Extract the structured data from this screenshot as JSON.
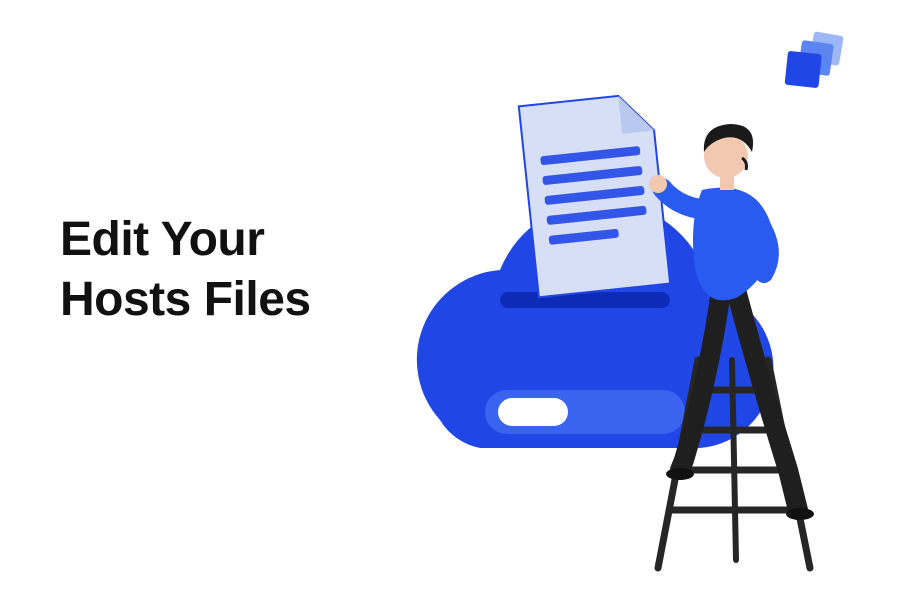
{
  "headline": {
    "line1": "Edit Your",
    "line2": "Hosts Files"
  },
  "colors": {
    "brand_primary": "#2146E6",
    "brand_light": "#5B86F2",
    "brand_lighter": "#9EB8F7",
    "document_fill": "#D6DFF5",
    "document_lines": "#3355E8",
    "skin": "#F2C8B0",
    "hair": "#1A1A1A",
    "pants": "#1F1F1F",
    "shirt": "#2A5BF0",
    "ladder": "#262626"
  }
}
